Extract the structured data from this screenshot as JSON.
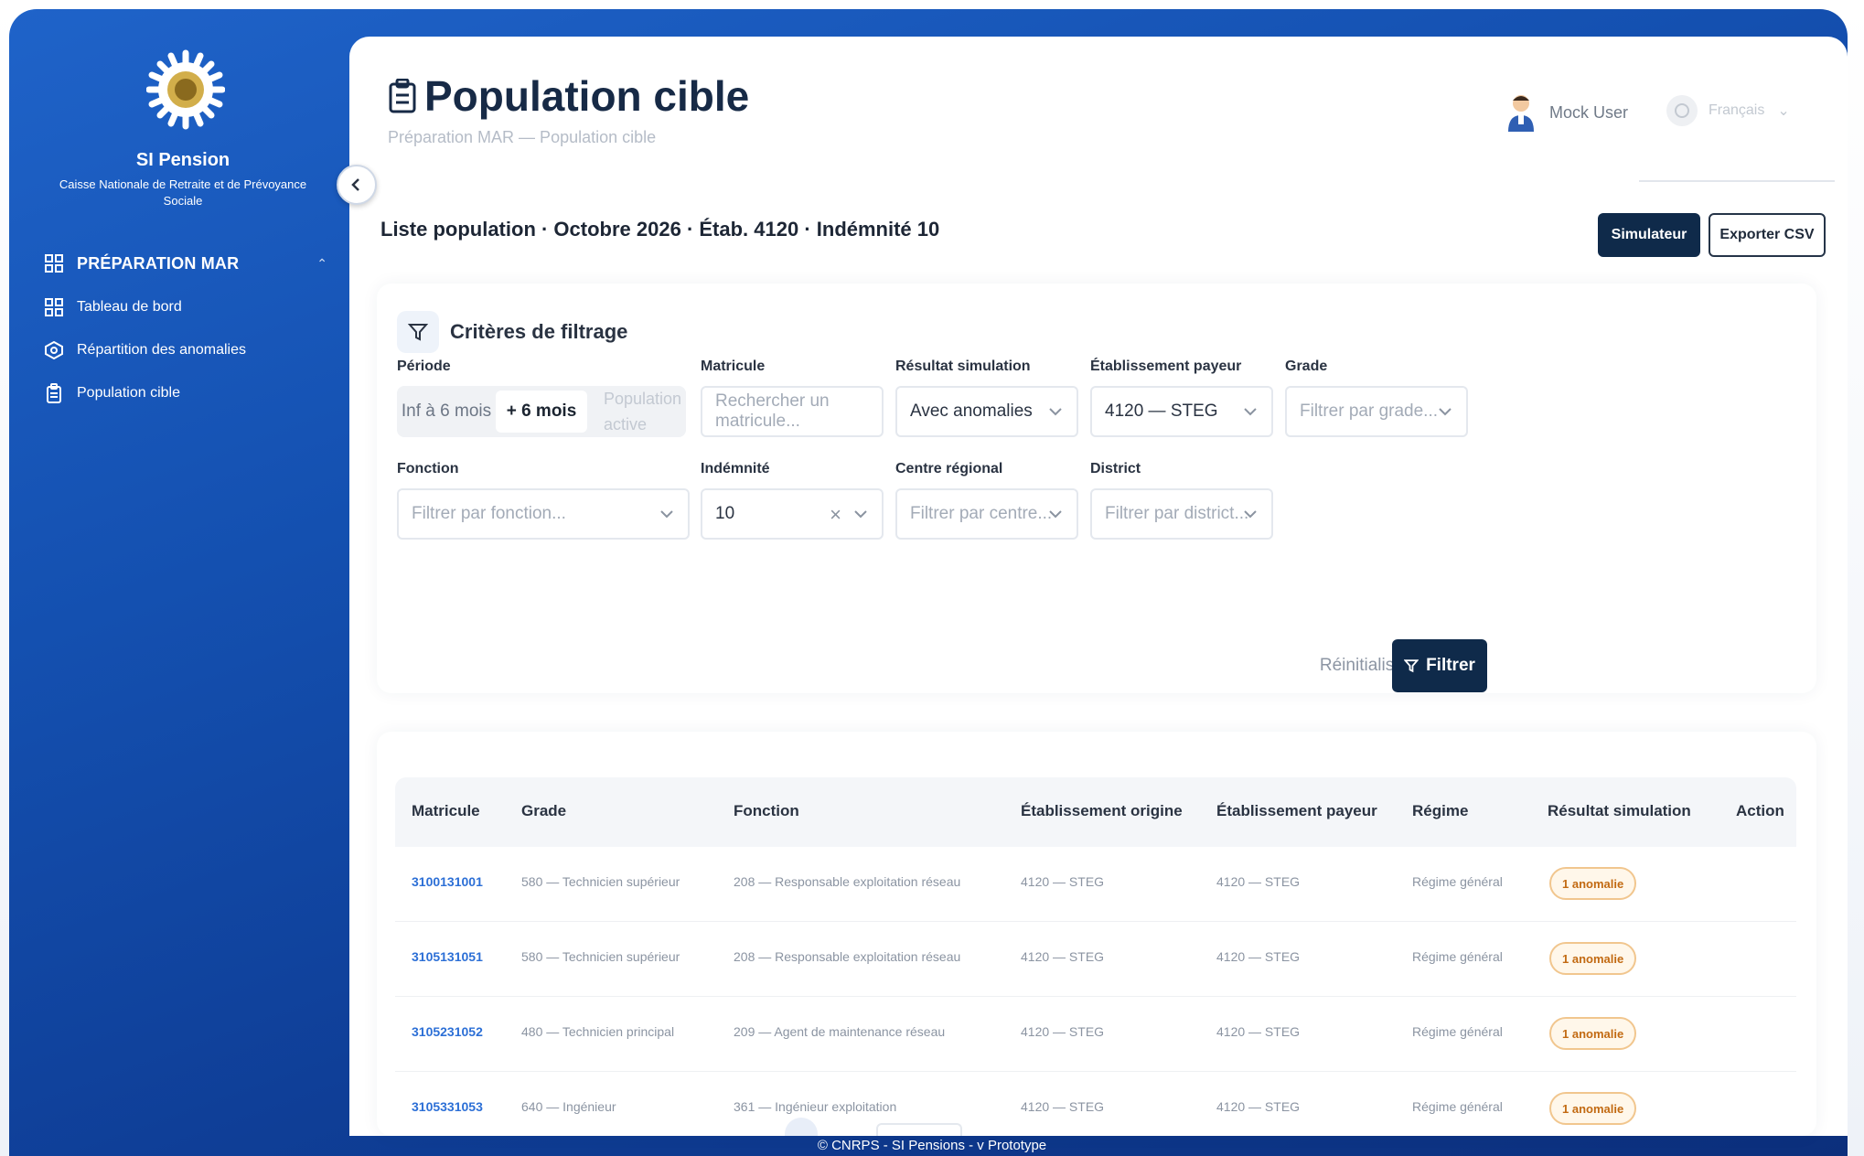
{
  "sidebar": {
    "brand_title": "SI Pension",
    "brand_subtitle": "Caisse Nationale de Retraite et de Prévoyance Sociale",
    "section_label": "PRÉPARATION MAR",
    "items": [
      {
        "label": "Tableau de bord",
        "icon": "dashboard-icon"
      },
      {
        "label": "Répartition des anomalies",
        "icon": "anomaly-icon"
      },
      {
        "label": "Population cible",
        "icon": "clipboard-icon"
      }
    ]
  },
  "header": {
    "title": "Population cible",
    "breadcrumb": "Préparation MAR — Population cible",
    "user_name": "Mock User",
    "language": "Français"
  },
  "list_title": "Liste population · Octobre 2026 · Étab. 4120 · Indémnité 10",
  "actions": {
    "simulate": "Simulateur",
    "export": "Exporter CSV"
  },
  "filters": {
    "title": "Critères de filtrage",
    "periode": {
      "label": "Période",
      "options": [
        "Inf à 6 mois",
        "+ 6 mois",
        "Population active"
      ],
      "selected": "+ 6 mois"
    },
    "matricule": {
      "label": "Matricule",
      "placeholder": "Rechercher un matricule..."
    },
    "resultat": {
      "label": "Résultat simulation",
      "value": "Avec anomalies"
    },
    "etablissement": {
      "label": "Établissement payeur",
      "value": "4120 — STEG"
    },
    "grade": {
      "label": "Grade",
      "placeholder": "Filtrer par grade..."
    },
    "fonction": {
      "label": "Fonction",
      "placeholder": "Filtrer par fonction..."
    },
    "indemnite": {
      "label": "Indémnité",
      "value": "10"
    },
    "centre": {
      "label": "Centre régional",
      "placeholder": "Filtrer par centre..."
    },
    "district": {
      "label": "District",
      "placeholder": "Filtrer par district..."
    },
    "reset_label": "Réinitialiser",
    "filter_label": "Filtrer"
  },
  "table": {
    "columns": [
      "Matricule",
      "Grade",
      "Fonction",
      "Établissement origine",
      "Établissement payeur",
      "Régime",
      "Résultat simulation",
      "Action"
    ],
    "rows": [
      {
        "matricule": "3100131001",
        "grade": "580 — Technicien supérieur",
        "fonction": "208 — Responsable exploitation réseau",
        "origine": "4120 — STEG",
        "payeur": "4120 — STEG",
        "regime": "Régime général",
        "resultat": "1 anomalie"
      },
      {
        "matricule": "3105131051",
        "grade": "580 — Technicien supérieur",
        "fonction": "208 — Responsable exploitation réseau",
        "origine": "4120 — STEG",
        "payeur": "4120 — STEG",
        "regime": "Régime général",
        "resultat": "1 anomalie"
      },
      {
        "matricule": "3105231052",
        "grade": "480 — Technicien principal",
        "fonction": "209 — Agent de maintenance réseau",
        "origine": "4120 — STEG",
        "payeur": "4120 — STEG",
        "regime": "Régime général",
        "resultat": "1 anomalie"
      },
      {
        "matricule": "3105331053",
        "grade": "640 — Ingénieur",
        "fonction": "361 — Ingénieur exploitation",
        "origine": "4120 — STEG",
        "payeur": "4120 — STEG",
        "regime": "Régime général",
        "resultat": "1 anomalie"
      }
    ]
  },
  "footer": "© CNRPS - SI Pensions - v Prototype",
  "colors": {
    "primary": "#0f2a4a",
    "sidebar": "#1450b0",
    "link": "#2c6fd6",
    "badge_border": "#f1c68e",
    "badge_text": "#c26a12"
  }
}
